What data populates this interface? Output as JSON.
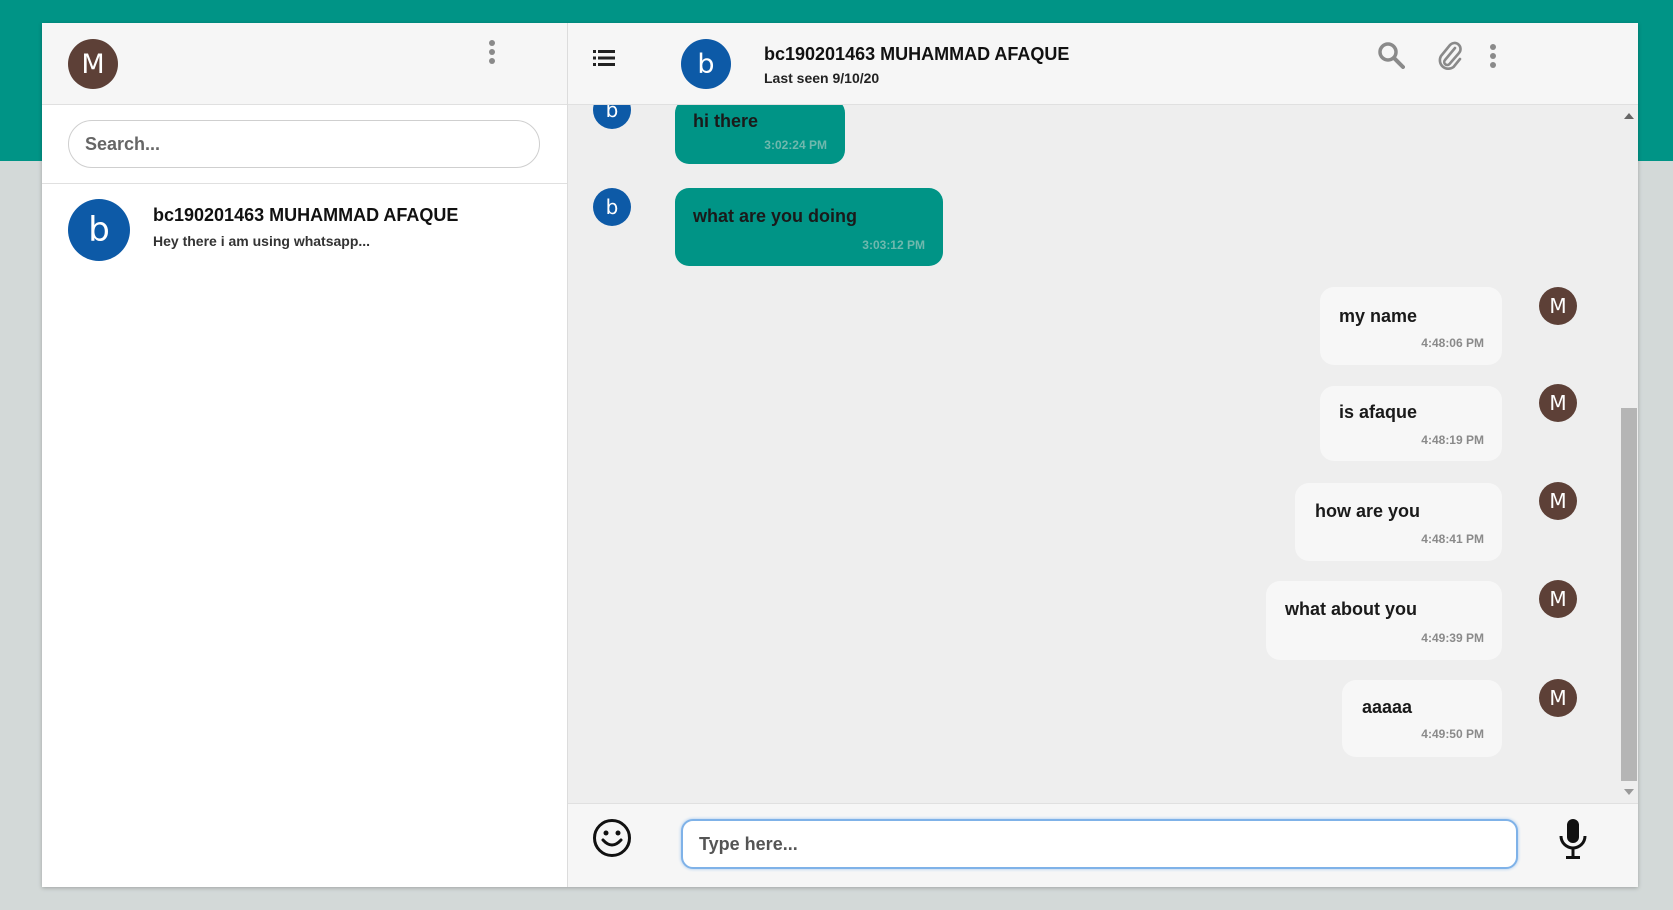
{
  "user": {
    "initial": "M",
    "avatar_color": "#5d4037"
  },
  "search": {
    "placeholder": "Search..."
  },
  "chat_list": [
    {
      "initial": "b",
      "name": "bc190201463 MUHAMMAD AFAQUE",
      "preview": "Hey there i am using whatsapp...",
      "avatar_color": "#0d5aa7"
    }
  ],
  "conversation": {
    "contact_initial": "b",
    "contact_name": "bc190201463 MUHAMMAD AFAQUE",
    "last_seen": "Last seen 9/10/20",
    "icons": [
      "list-icon",
      "search-icon",
      "paperclip-icon",
      "more-vert-icon"
    ]
  },
  "messages": [
    {
      "direction": "in",
      "avatar": "b",
      "text": "hi there",
      "time": "3:02:24 PM"
    },
    {
      "direction": "in",
      "avatar": "b",
      "text": "what are you doing",
      "time": "3:03:12 PM"
    },
    {
      "direction": "out",
      "avatar": "M",
      "text": "my name",
      "time": "4:48:06 PM"
    },
    {
      "direction": "out",
      "avatar": "M",
      "text": "is afaque",
      "time": "4:48:19 PM"
    },
    {
      "direction": "out",
      "avatar": "M",
      "text": "how are you",
      "time": "4:48:41 PM"
    },
    {
      "direction": "out",
      "avatar": "M",
      "text": "what about you",
      "time": "4:49:39 PM"
    },
    {
      "direction": "out",
      "avatar": "M",
      "text": "aaaaa",
      "time": "4:49:50 PM"
    }
  ],
  "composer": {
    "placeholder": "Type here..."
  },
  "colors": {
    "brand": "#009486",
    "incoming_bubble": "#009486",
    "outgoing_bubble": "#f7f7f7",
    "contact_avatar": "#0d5aa7"
  }
}
